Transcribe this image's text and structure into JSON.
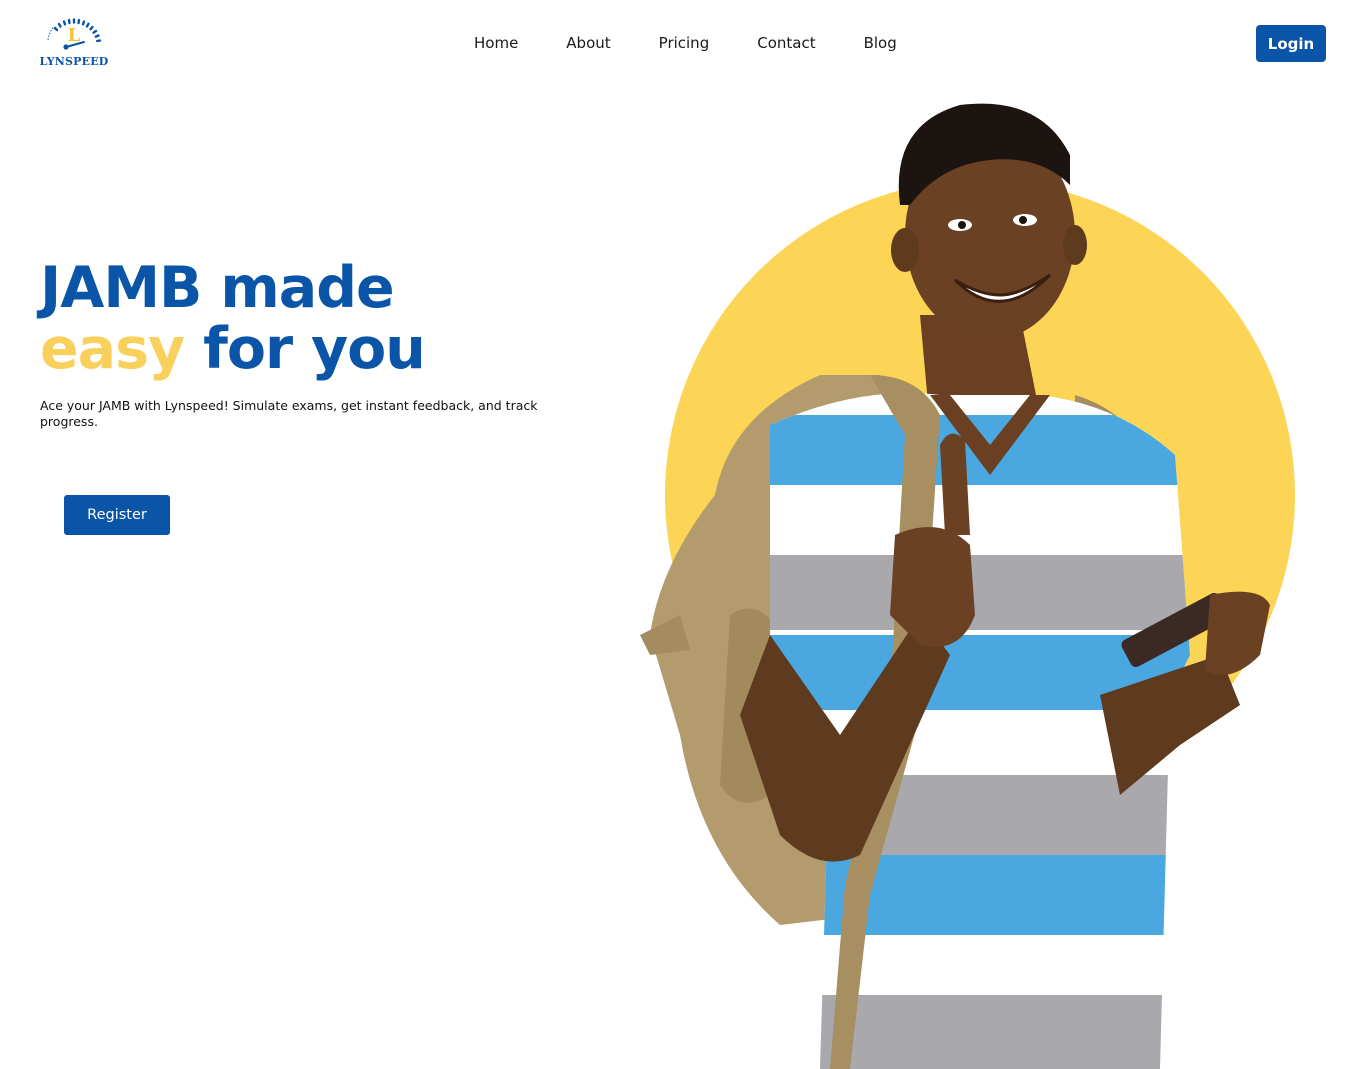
{
  "brand": {
    "logo_letter": "L",
    "logo_text": "LYNSPEED",
    "primary_color": "#0b55a8",
    "accent_color": "#f9d05c"
  },
  "nav": {
    "items": [
      {
        "label": "Home"
      },
      {
        "label": "About"
      },
      {
        "label": "Pricing"
      },
      {
        "label": "Contact"
      },
      {
        "label": "Blog"
      }
    ],
    "login_label": "Login"
  },
  "hero": {
    "title_line1": "JAMB made",
    "title_accent": "easy",
    "title_line2_rest": " for you",
    "subtitle": "Ace your JAMB with Lynspeed! Simulate exams, get instant feedback, and track progress.",
    "register_label": "Register"
  },
  "hero_image": {
    "icon": "student-thumbs-up-photo",
    "circle_color": "#fcd456"
  }
}
